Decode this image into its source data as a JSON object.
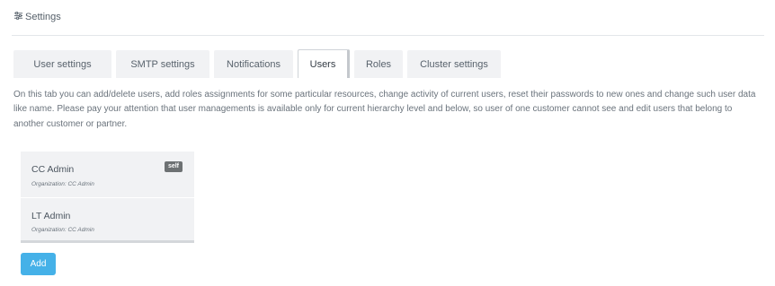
{
  "header": {
    "icon": "sliders-icon",
    "title": "Settings"
  },
  "tabs": [
    {
      "label": "User settings",
      "active": false
    },
    {
      "label": "SMTP settings",
      "active": false
    },
    {
      "label": "Notifications",
      "active": false
    },
    {
      "label": "Users",
      "active": true
    },
    {
      "label": "Roles",
      "active": false
    },
    {
      "label": "Cluster settings",
      "active": false
    }
  ],
  "description": "On this tab you can add/delete users, add roles assignments for some particular resources, change activity of current users, reset their passwords to new ones and change such user data like name. Please pay your attention that user managements is available only for current hierarchy level and below, so user of one customer cannot see and edit users that belong to another customer or partner.",
  "users": [
    {
      "name": "CC Admin",
      "organization": "Organization: CC Admin",
      "badge": "self"
    },
    {
      "name": "LT Admin",
      "organization": "Organization: CC Admin",
      "badge": ""
    }
  ],
  "actions": {
    "add_label": "Add"
  },
  "colors": {
    "accent": "#45b1e8",
    "badge": "#6d7173",
    "tab_background": "#f1f2f4"
  }
}
